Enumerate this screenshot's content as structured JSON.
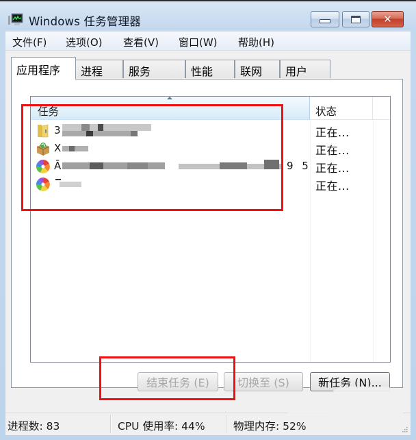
{
  "window": {
    "title": "Windows 任务管理器",
    "icon": "task-manager-monitor-icon",
    "controls": {
      "minimize": "minimize-icon",
      "maximize": "maximize-icon",
      "close": "close-icon",
      "close_glyph": "✕"
    }
  },
  "menu": {
    "items": [
      {
        "label": "文件(F)"
      },
      {
        "label": "选项(O)"
      },
      {
        "label": "查看(V)"
      },
      {
        "label": "窗口(W)"
      },
      {
        "label": "帮助(H)"
      }
    ]
  },
  "tabs": [
    {
      "label": "应用程序",
      "active": true
    },
    {
      "label": "进程",
      "active": false
    },
    {
      "label": "服务",
      "active": false
    },
    {
      "label": "性能",
      "active": false
    },
    {
      "label": "联网",
      "active": false
    },
    {
      "label": "用户",
      "active": false
    }
  ],
  "task_list": {
    "columns": [
      {
        "label": "任务",
        "sorted": "ascending"
      },
      {
        "label": "状态"
      }
    ],
    "rows": [
      {
        "icon": "folder-icon",
        "name_visible": "3",
        "name_obscured": true,
        "suffix": "",
        "status": "正在..."
      },
      {
        "icon": "package-box-icon",
        "name_visible": "X",
        "name_obscured": true,
        "suffix": "",
        "status": "正在..."
      },
      {
        "icon": "color-wheel-icon",
        "name_visible": "Ā",
        "name_obscured": true,
        "suffix": "9 5",
        "status": "正在..."
      },
      {
        "icon": "color-wheel-icon",
        "name_visible": "",
        "name_obscured": true,
        "suffix": "",
        "status": "正在..."
      }
    ]
  },
  "buttons": {
    "end_task": {
      "label": "结束任务 (E)",
      "enabled": false
    },
    "switch_to": {
      "label": "切换至 (S)",
      "enabled": false
    },
    "new_task": {
      "label": "新任务 (N)...",
      "enabled": true
    }
  },
  "statusbar": {
    "processes": "进程数: 83",
    "cpu": "CPU 使用率: 44%",
    "memory": "物理内存: 52%"
  },
  "annotations": {
    "highlight_color": "#f20f0f"
  }
}
